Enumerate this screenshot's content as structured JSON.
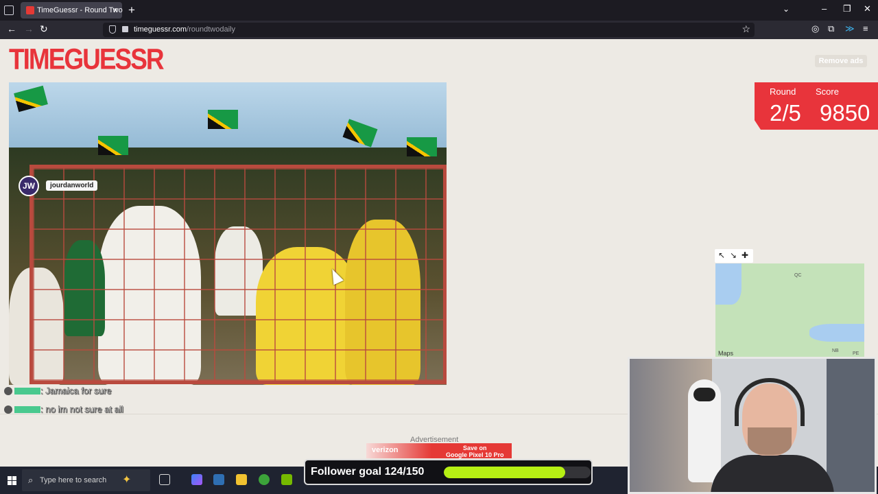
{
  "browser": {
    "tab_title": "TimeGuessr - Round Two",
    "url_domain": "timeguessr.com",
    "url_path": "/roundtwodaily"
  },
  "site": {
    "logo_text": "TIMEGUESSR",
    "remove_ads_label": "Remove ads"
  },
  "photo": {
    "watermark_name": "jourdanworld",
    "watermark_avatar_text": "JW"
  },
  "score": {
    "round_label": "Round",
    "score_label": "Score",
    "round_value": "2/5",
    "score_value": "9850"
  },
  "map": {
    "labels": [
      "QC",
      "NB",
      "PE"
    ],
    "credit": "Maps"
  },
  "chat": [
    {
      "message": ": Jamaica for sure"
    },
    {
      "message": ": no im not sure at all"
    }
  ],
  "ad": {
    "label": "Advertisement",
    "brand": "verizon",
    "line1": "Save on",
    "line2": "Google Pixel 10 Pro"
  },
  "taskbar": {
    "search_placeholder": "Type here to search"
  },
  "follower_goal": {
    "text": "Follower goal 124/150",
    "current": 124,
    "goal": 150
  },
  "colors": {
    "brand_red": "#e8343b",
    "page_bg": "#edeae4",
    "progress_green": "#b6f014"
  }
}
